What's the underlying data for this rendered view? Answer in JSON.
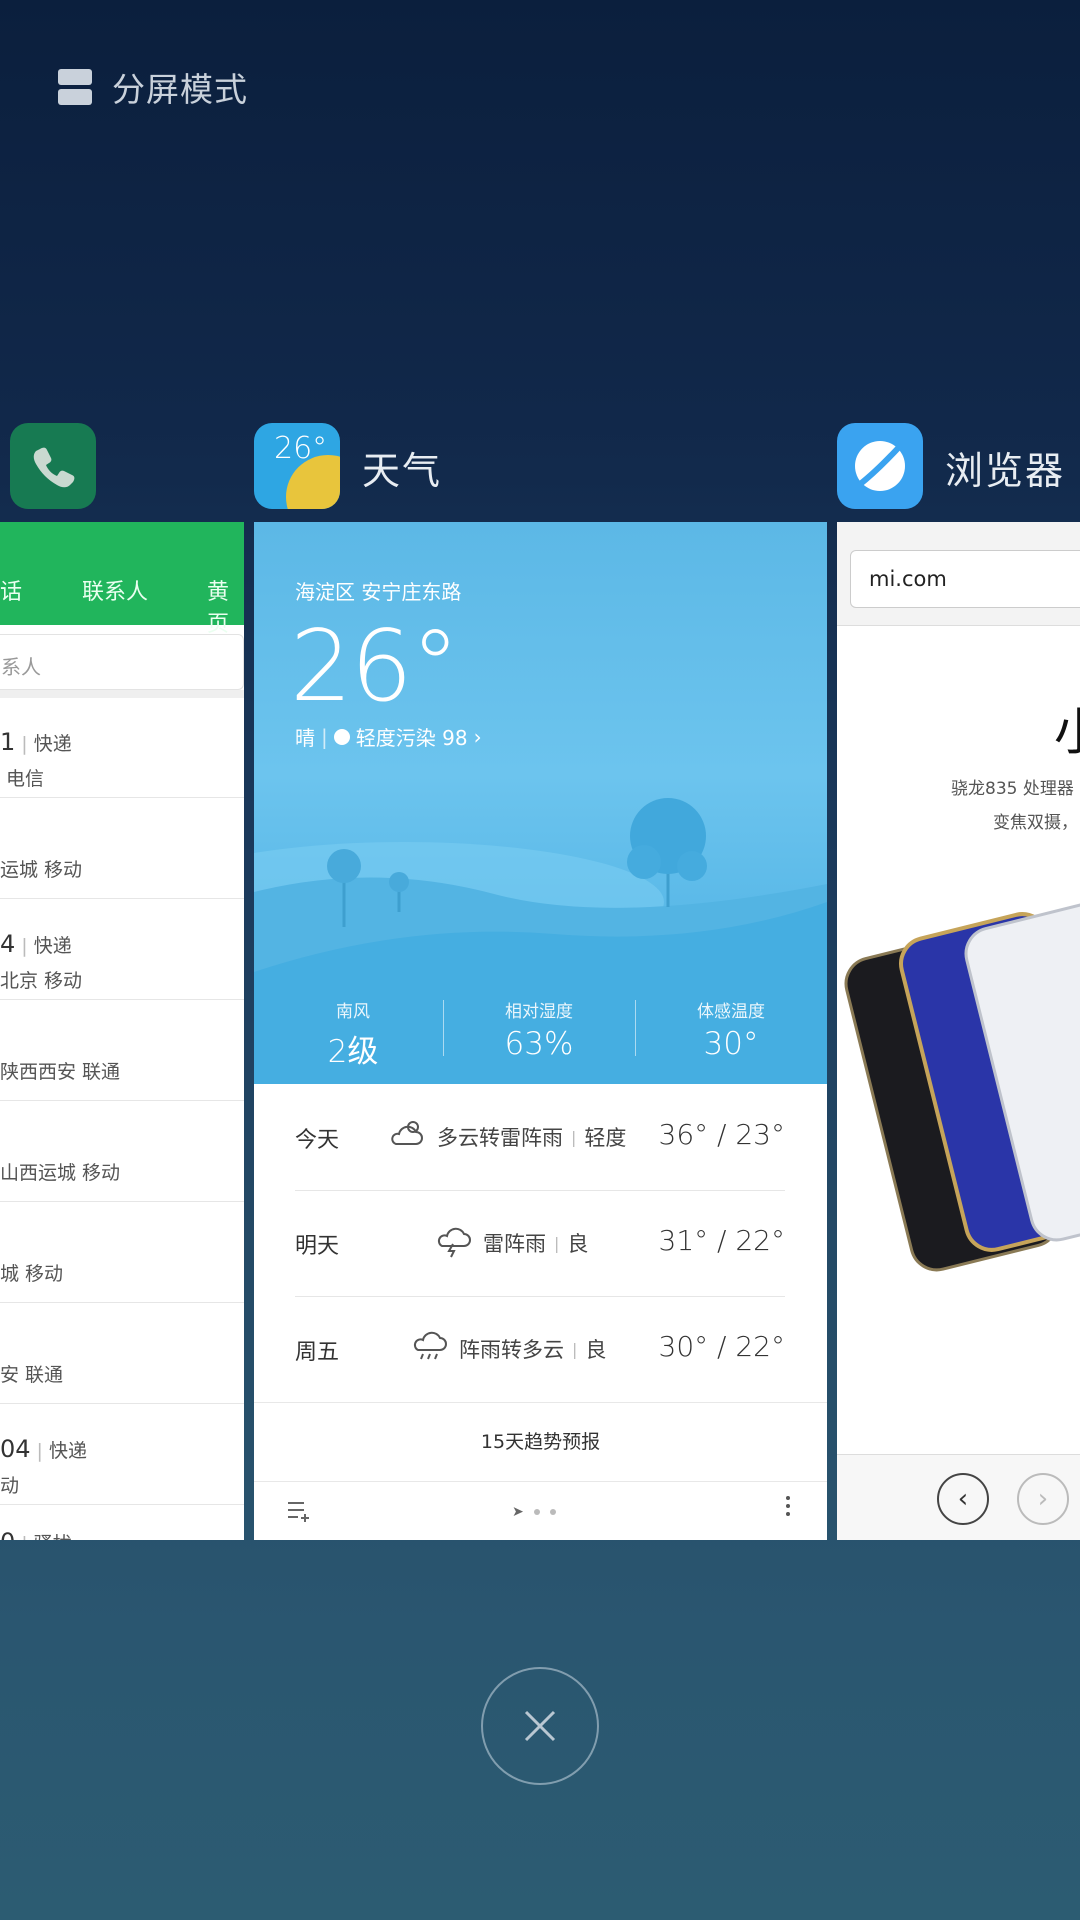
{
  "split_mode": {
    "label": "分屏模式",
    "icon": "split-screen-icon"
  },
  "apps": {
    "phone": {
      "name": "",
      "icon": "phone-icon",
      "color": "#177a52"
    },
    "weather": {
      "name": "天气",
      "icon_temp": "26°",
      "icon": "weather-icon"
    },
    "browser": {
      "name": "浏览器",
      "icon": "browser-icon",
      "color": "#3aa3f0"
    }
  },
  "phone_card": {
    "tabs": [
      "话",
      "联系人",
      "黄页"
    ],
    "search_placeholder": "系人",
    "calls": [
      {
        "line1": "1",
        "tag": "快递",
        "line2": "电信"
      },
      {
        "line1": "",
        "tag": "",
        "line2": "运城 移动"
      },
      {
        "line1": "4",
        "tag": "快递",
        "line2": "北京 移动"
      },
      {
        "line1": "",
        "tag": "",
        "line2": "陕西西安 联通"
      },
      {
        "line1": "",
        "tag": "",
        "line2": "山西运城 移动"
      },
      {
        "line1": "",
        "tag": "",
        "line2": "城 移动"
      },
      {
        "line1": "",
        "tag": "",
        "line2": "安 联通"
      },
      {
        "line1": "04",
        "tag": "快递",
        "line2": "动"
      },
      {
        "line1": "0",
        "tag": "骚扰",
        "line2": ""
      }
    ]
  },
  "weather_card": {
    "location": "海淀区  安宁庄东路",
    "temperature": "26°",
    "condition": "晴",
    "pollution": "轻度污染 98",
    "metrics": [
      {
        "label": "南风",
        "value": "2级"
      },
      {
        "label": "相对湿度",
        "value": "63%"
      },
      {
        "label": "体感温度",
        "value": "30°"
      }
    ],
    "forecast": [
      {
        "day": "今天",
        "desc": "多云转雷阵雨",
        "aqi": "轻度",
        "temps": "36° / 23°",
        "icon": "partly-cloudy-icon"
      },
      {
        "day": "明天",
        "desc": "雷阵雨",
        "aqi": "良",
        "temps": "31° / 22°",
        "icon": "thunderstorm-icon"
      },
      {
        "day": "周五",
        "desc": "阵雨转多云",
        "aqi": "良",
        "temps": "30° / 22°",
        "icon": "shower-icon"
      }
    ],
    "trend_label": "15天趋势预报"
  },
  "browser_card": {
    "url": "mi.com",
    "big_char": "小",
    "text_line1": "骁龙835 处理器",
    "text_line2": "变焦双摄，"
  },
  "close_all": {
    "icon": "close-icon"
  }
}
